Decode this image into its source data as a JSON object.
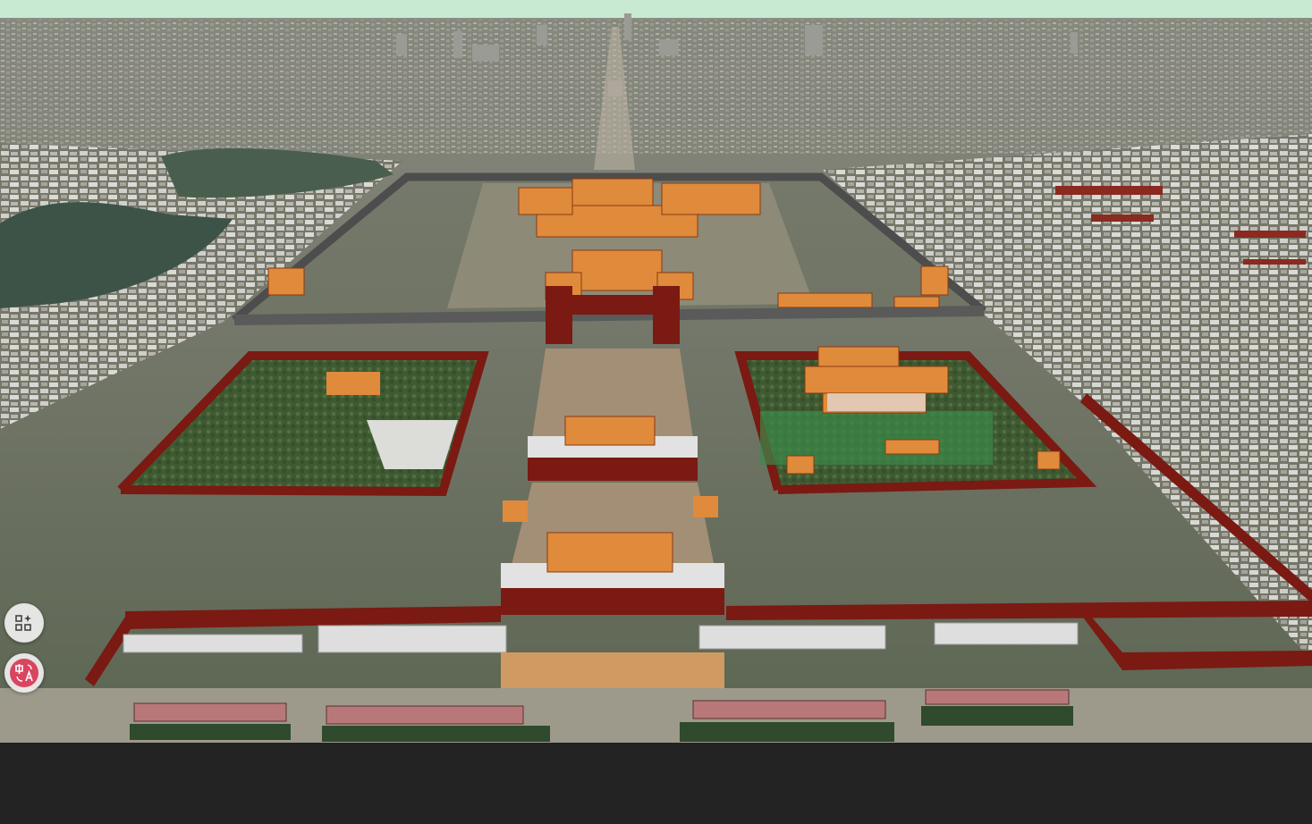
{
  "map": {
    "view": "3d-satellite",
    "colors": {
      "sky": "#c9ead2",
      "ground": "#6f7766",
      "ground_far": "#8a8b80",
      "vegetation": "#3f5a32",
      "water": "#3d5348",
      "palace_wall": "#7a1a12",
      "palace_roof": "#e08a3c",
      "building": "#e2e2e2",
      "gray_wall": "#5a5a5a",
      "plaza": "#b8a58e",
      "bottom_bar": "#232323"
    }
  },
  "controls": {
    "widget_button": {
      "icon": "grid-sparkle-icon"
    },
    "language_button": {
      "icon": "translate-icon",
      "accent": "#d9455f"
    }
  }
}
